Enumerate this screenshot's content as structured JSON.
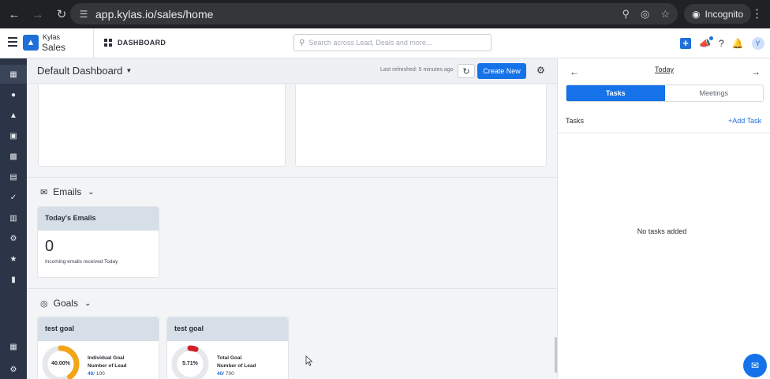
{
  "browser": {
    "url": "app.kylas.io/sales/home",
    "profile_label": "Incognito",
    "icons": [
      "back-icon",
      "forward-icon",
      "reload-icon",
      "site-settings-icon",
      "zoom-icon",
      "eye-off-icon",
      "star-icon",
      "incognito-icon",
      "menu-icon"
    ]
  },
  "header": {
    "brand_top": "Kylas",
    "brand_bottom": "Sales",
    "section_title": "DASHBOARD",
    "search_placeholder": "Search across Lead, Deals and more...",
    "avatar_initial": "Y",
    "accent_color": "#1572e8"
  },
  "sidebar": {
    "items": [
      "dashboard-icon",
      "contacts-icon",
      "leads-icon",
      "deals-icon",
      "companies-icon",
      "notes-icon",
      "tasks-icon",
      "calendar-icon",
      "workflow-icon",
      "marketing-icon",
      "reports-icon"
    ],
    "bottom_items": [
      "apps-grid-icon",
      "settings-icon"
    ]
  },
  "toolbar": {
    "dashboard_name": "Default Dashboard",
    "last_refreshed": "Last refreshed: 5 minutes ago",
    "create_new": "Create New"
  },
  "emails": {
    "section_title": "Emails",
    "card": {
      "title": "Today's Emails",
      "count": "0",
      "subtitle": "Incoming emails received Today"
    }
  },
  "goals": {
    "section_title": "Goals",
    "cards": [
      {
        "title": "test goal",
        "percent_label": "40.00%",
        "percent": 40.0,
        "ring_color": "#f2a516",
        "line1": "Individual Goal",
        "line2": "Number of Lead",
        "achieved": "40",
        "target": "/ 100"
      },
      {
        "title": "test goal",
        "percent_label": "5.71%",
        "percent": 5.71,
        "ring_color": "#d11f27",
        "line1": "Total Goal",
        "line2": "Number of Lead",
        "achieved": "40",
        "target": "/ 700"
      }
    ]
  },
  "right_panel": {
    "date_label": "Today",
    "tabs": [
      "Tasks",
      "Meetings"
    ],
    "active_tab": "Tasks",
    "tasks_label": "Tasks",
    "add_task": "Add Task",
    "empty_message": "No tasks added"
  }
}
